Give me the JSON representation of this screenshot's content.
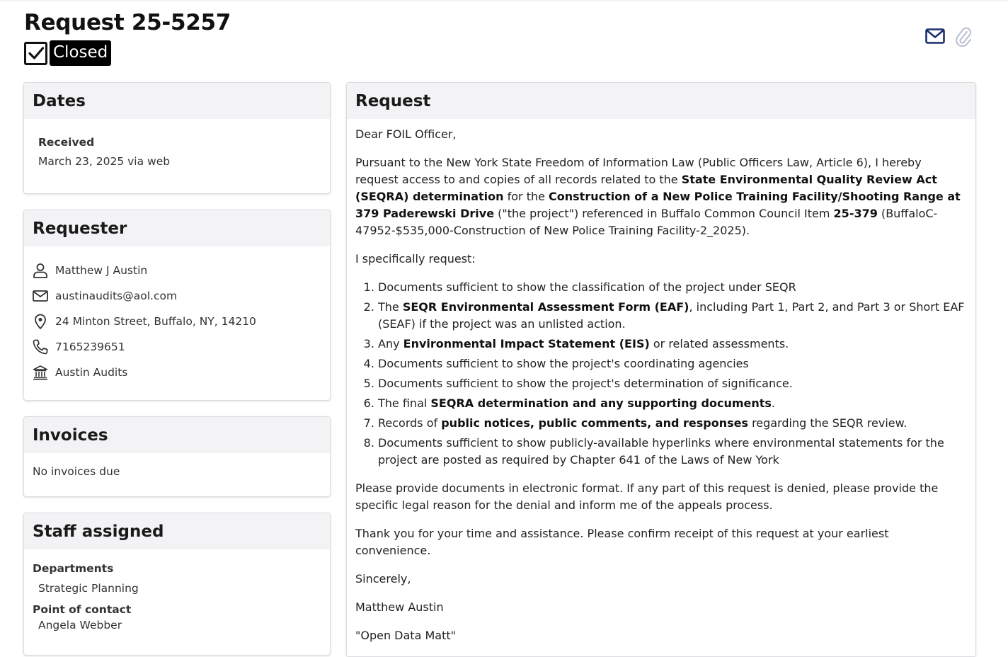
{
  "header": {
    "title": "Request 25-5257",
    "status": "Closed"
  },
  "icons": {
    "email": "envelope-icon",
    "attach": "paperclip-icon",
    "check": "checkbox-checked-icon",
    "person": "person-icon",
    "location": "map-pin-icon",
    "phone": "phone-icon",
    "org": "building-icon"
  },
  "colors": {
    "accent": "#1c2f6e",
    "status_bg": "#000000",
    "card_header_bg": "#f3f3f5"
  },
  "dates": {
    "heading": "Dates",
    "received_label": "Received",
    "received_value": "March 23, 2025 via web"
  },
  "requester": {
    "heading": "Requester",
    "name": "Matthew J Austin",
    "email": "austinaudits@aol.com",
    "address": "24 Minton Street, Buffalo, NY, 14210",
    "phone": "7165239651",
    "organization": "Austin Audits"
  },
  "invoices": {
    "heading": "Invoices",
    "text": "No invoices due"
  },
  "staff": {
    "heading": "Staff assigned",
    "departments_label": "Departments",
    "department": "Strategic Planning",
    "poc_label": "Point of contact",
    "poc": "Angela Webber"
  },
  "request": {
    "heading": "Request",
    "greeting": "Dear FOIL Officer,",
    "p1": {
      "a": "Pursuant to the New York State Freedom of Information Law (Public Officers Law, Article 6), I hereby request access to and copies of all records related to the ",
      "b": "State Environmental Quality Review Act (SEQRA) determination",
      "c": " for the ",
      "d": "Construction of a New Police Training Facility/Shooting Range at 379 Paderewski Drive",
      "e": " (\"the project\") referenced in Buffalo Common Council Item ",
      "f": "25-379",
      "g": " (BuffaloC-47952-$535,000-Construction of New Police Training Facility-2_2025)."
    },
    "intro": "I specifically request:",
    "items": {
      "i1": "Documents sufficient to show the classification of the project under SEQR",
      "i2a": "The ",
      "i2b": "SEQR Environmental Assessment Form (EAF)",
      "i2c": ", including Part 1, Part 2, and Part 3 or Short EAF (SEAF) if the project was an unlisted action.",
      "i3a": "Any ",
      "i3b": "Environmental Impact Statement (EIS)",
      "i3c": " or related assessments.",
      "i4": "Documents sufficient to show the project's coordinating agencies",
      "i5": "Documents sufficient to show the project's determination of significance.",
      "i6a": "The final ",
      "i6b": "SEQRA determination and any supporting documents",
      "i6c": ".",
      "i7a": "Records of ",
      "i7b": "public notices, public comments, and responses",
      "i7c": " regarding the SEQR review.",
      "i8": "Documents sufficient to show publicly-available hyperlinks where environmental statements for the project are posted as required by Chapter 641 of the Laws of New York"
    },
    "p_format": "Please provide documents in electronic format. If any part of this request is denied, please provide the specific legal reason for the denial and inform me of the appeals process.",
    "p_thanks": "Thank you for your time and assistance. Please confirm receipt of this request at your earliest convenience.",
    "closing": "Sincerely,",
    "signature": "Matthew Austin",
    "nickname": "\"Open Data Matt\""
  }
}
